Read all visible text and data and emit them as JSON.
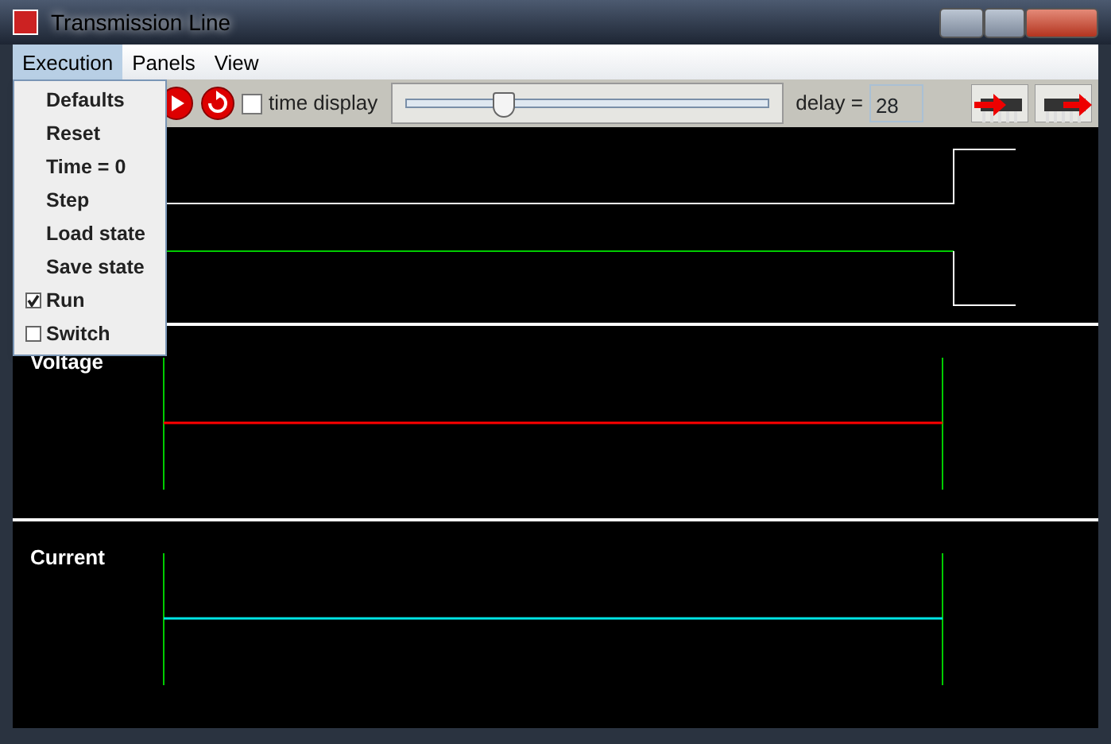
{
  "window": {
    "title": "Transmission Line"
  },
  "menubar": [
    {
      "label": "Execution",
      "selected": true
    },
    {
      "label": "Panels",
      "selected": false
    },
    {
      "label": "View",
      "selected": false
    }
  ],
  "menu": [
    {
      "kind": "item",
      "label": "Defaults"
    },
    {
      "kind": "item",
      "label": "Reset"
    },
    {
      "kind": "item",
      "label": "Time = 0"
    },
    {
      "kind": "item",
      "label": "Step"
    },
    {
      "kind": "item",
      "label": "Load state"
    },
    {
      "kind": "item",
      "label": "Save state"
    },
    {
      "kind": "check",
      "label": "Run",
      "checked": true
    },
    {
      "kind": "check",
      "label": "Switch",
      "checked": false
    }
  ],
  "toolbar": {
    "time_display": {
      "label": "time display",
      "checked": false
    },
    "slider": {
      "level": 0.27
    },
    "delay": {
      "label": "delay =",
      "value": "28"
    }
  },
  "plots": [
    {
      "title": "Voltage",
      "color": "#ff0000"
    },
    {
      "title": "Current",
      "color": "#00e5e5"
    }
  ]
}
